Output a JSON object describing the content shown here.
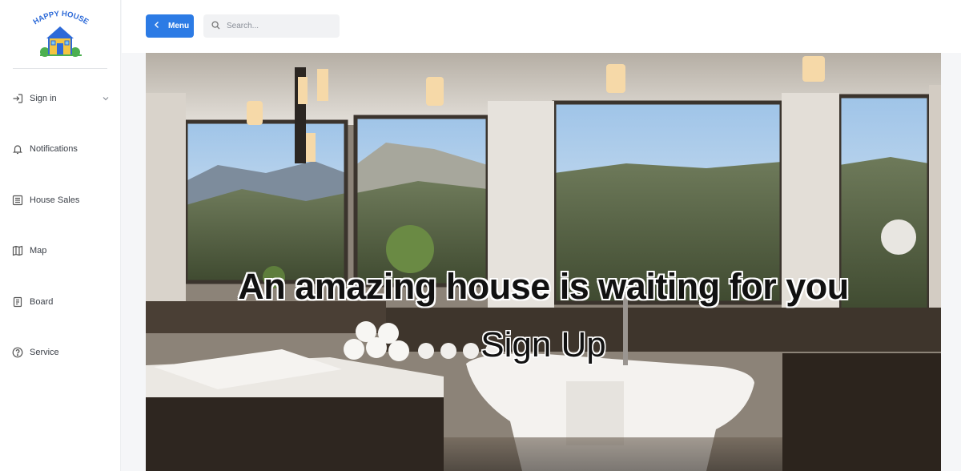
{
  "sidebar": {
    "logo_text": "HAPPY HOUSE",
    "items": [
      {
        "label": "Sign in",
        "icon": "sign-in-icon",
        "has_submenu": true
      },
      {
        "label": "Notifications",
        "icon": "bell-icon"
      },
      {
        "label": "House Sales",
        "icon": "list-icon"
      },
      {
        "label": "Map",
        "icon": "map-icon"
      },
      {
        "label": "Board",
        "icon": "document-icon"
      },
      {
        "label": "Service",
        "icon": "question-circle-icon"
      }
    ]
  },
  "header": {
    "menu_label": "Menu",
    "search_placeholder": "Search..."
  },
  "hero": {
    "title": "An amazing house is waiting for you",
    "cta": "Sign Up"
  },
  "colors": {
    "accent": "#2c7be5",
    "sidebar_bg": "#ffffff",
    "page_bg": "#f5f6f8"
  }
}
